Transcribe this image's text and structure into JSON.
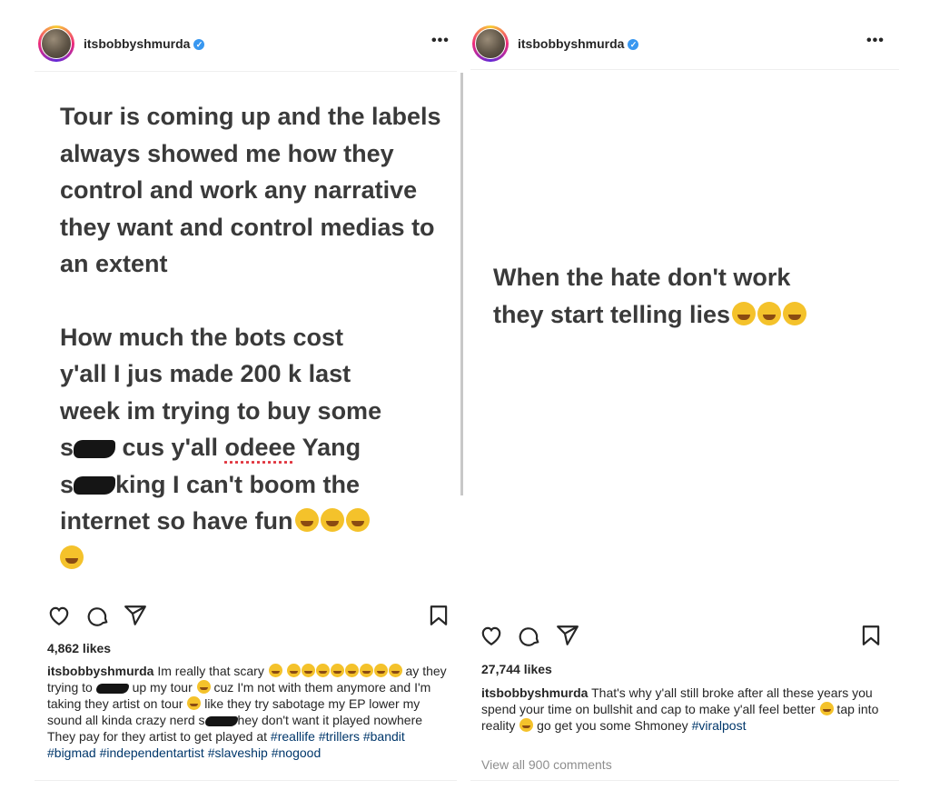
{
  "left": {
    "username": "itsbobbyshmurda",
    "more": "•••",
    "body_para1": "Tour is coming up and the labels always showed me how they control and work any narrative they want and control medias to an extent",
    "body_l1": "How much the bots cost",
    "body_l2": "y'all I jus made 200 k last",
    "body_l3": "week im trying to buy some",
    "body_l4a": "s",
    "body_l4b": " cus y'all ",
    "body_l4c": "odeee",
    "body_l4d": " Yang",
    "body_l5a": "s",
    "body_l5b": "king I can't boom the",
    "body_l6": "internet so have fun",
    "likes": "4,862 likes",
    "caption_user": "itsbobbyshmurda",
    "caption_a": " Im really that scary ",
    "caption_b": " ay they trying to ",
    "caption_c": " up my tour ",
    "caption_d": " cuz I'm not with them anymore and I'm taking they artist on tour ",
    "caption_e": " like they try sabotage my EP lower my sound all kinda crazy nerd s",
    "caption_f": "hey don't want it played nowhere They pay for they artist to get played at ",
    "hashtags": [
      "#reallife",
      "#trillers",
      "#bandit",
      "#bigmad",
      "#independentartist",
      "#slaveship",
      "#nogood"
    ]
  },
  "right": {
    "username": "itsbobbyshmurda",
    "more": "•••",
    "body_l1": "When the hate don't work",
    "body_l2": "they start telling lies",
    "likes": "27,744 likes",
    "caption_user": "itsbobbyshmurda",
    "caption_a": " That's why y'all still broke after all these years you spend your time on bullshit and cap to make y'all feel better ",
    "caption_b": " tap into reality ",
    "caption_c": " go get you some Shmoney ",
    "hashtag": "#viralpost",
    "view_comments": "View all 900 comments"
  },
  "icons": [
    "heart-icon",
    "comment-icon",
    "share-icon",
    "bookmark-icon",
    "verified-icon",
    "more-icon",
    "laughing-emoji",
    "grimace-emoji",
    "scream-emoji",
    "pleading-emoji",
    "wink-emoji"
  ],
  "colors": {
    "hashtag": "#00376b",
    "verified": "#3897f0",
    "text": "#262626",
    "muted": "#8e8e8e"
  }
}
